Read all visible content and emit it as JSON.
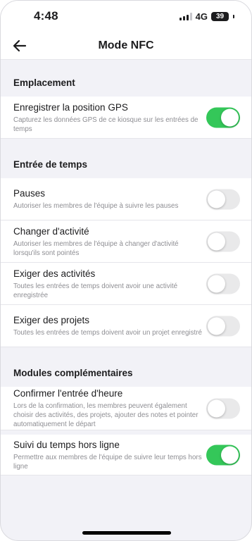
{
  "status_bar": {
    "time": "4:48",
    "network": "4G",
    "battery": "39"
  },
  "header": {
    "title": "Mode NFC"
  },
  "sections": [
    {
      "title": "Emplacement",
      "items": [
        {
          "title": "Enregistrer la position GPS",
          "description": "Capturez les données GPS de ce kiosque sur les entrées de temps",
          "enabled": true
        }
      ]
    },
    {
      "title": "Entrée de temps",
      "items": [
        {
          "title": "Pauses",
          "description": "Autoriser les membres de l'équipe à suivre les pauses",
          "enabled": false
        },
        {
          "title": "Changer d'activité",
          "description": "Autoriser les membres de l'équipe à changer d'activité lorsqu'ils sont pointés",
          "enabled": false
        },
        {
          "title": "Exiger des activités",
          "description": "Toutes les entrées de temps doivent avoir une activité enregistrée",
          "enabled": false
        },
        {
          "title": "Exiger des projets",
          "description": "Toutes les entrées de temps doivent avoir un projet enregistré",
          "enabled": false
        }
      ]
    },
    {
      "title": "Modules complémentaires",
      "items": [
        {
          "title": "Confirmer l'entrée d'heure",
          "description": "Lors de la confirmation, les membres peuvent également choisir des activités, des projets, ajouter des notes et pointer automatiquement le départ",
          "enabled": false
        },
        {
          "title": "Suivi du temps hors ligne",
          "description": "Permettre aux membres de l'équipe de suivre leur temps hors ligne",
          "enabled": true
        }
      ]
    }
  ],
  "colors": {
    "toggle_on": "#34c759",
    "toggle_off": "#e9e9ea",
    "background": "#f2f2f7"
  },
  "icons": {
    "back": "arrow-left-icon"
  }
}
